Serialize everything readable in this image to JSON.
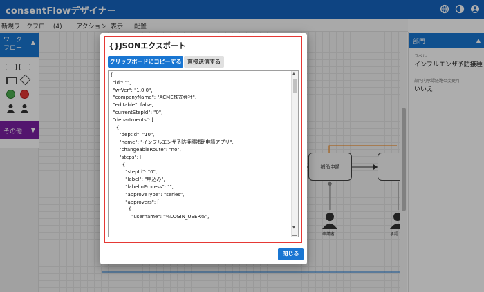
{
  "app": {
    "title": "consentFlowデザイナー",
    "icons": [
      "globe-icon",
      "theme-icon",
      "account-icon"
    ]
  },
  "menubar": {
    "workflow_name": "新規ワークフロー (4)",
    "items": [
      "アクション",
      "表示",
      "配置"
    ]
  },
  "palette": {
    "workflow_section": "ワーク\nフロー",
    "other_section": "その他"
  },
  "right_panel": {
    "section": "部門",
    "label_caption": "ラベル",
    "label_value": "インフルエンザ予防接種補助",
    "route_caption": "部門内承認経路の変更可",
    "route_value": "いいえ"
  },
  "canvas": {
    "node_label": "補助申請",
    "persons": [
      "申請者",
      "承認"
    ]
  },
  "dialog": {
    "title": "{}JSONエクスポート",
    "copy_button": "クリップボードにコピーする",
    "send_button": "直接送信する",
    "close_button": "閉じる",
    "json_lines": [
      "{",
      "  \"id\": \"\",",
      "  \"wfVer\": \"1.0.0\",",
      "  \"companyName\": \"ACME株式会社\",",
      "  \"editable\": false,",
      "  \"currentStepId\": \"0\",",
      "  \"departments\": [",
      "    {",
      "      \"deptId\": \"10\",",
      "      \"name\": \"インフルエンザ予防接種補助申請アプリ\",",
      "      \"changeableRoute\": \"no\",",
      "      \"steps\": [",
      "        {",
      "          \"stepId\": \"0\",",
      "          \"label\": \"申込み\",",
      "          \"labelInProcess\": \"\",",
      "          \"approveType\": \"series\",",
      "          \"approvers\": [",
      "            {",
      "              \"username\": \"%LOGIN_USER%\","
    ]
  },
  "colors": {
    "primary": "#1976d2",
    "appbar": "#1565c0",
    "highlight": "#e53935",
    "other_section": "#7b1fa2"
  }
}
